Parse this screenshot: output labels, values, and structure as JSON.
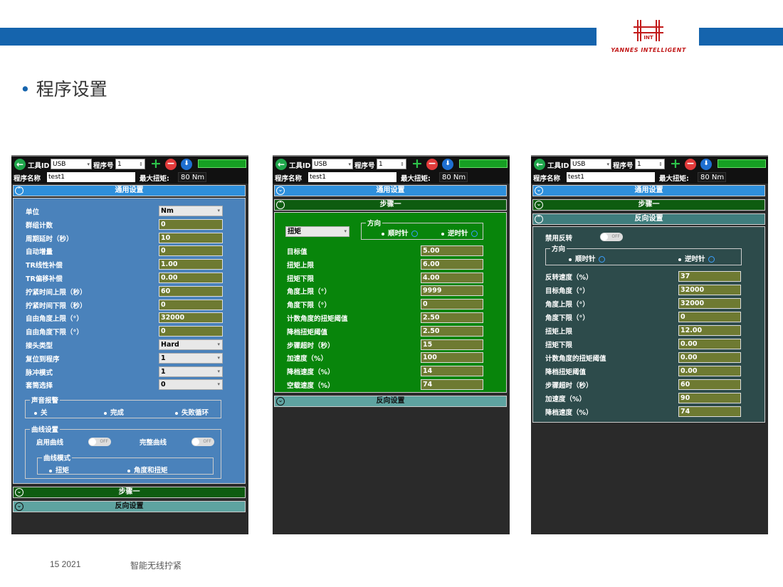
{
  "slide": {
    "title": "程序设置",
    "footer_number": "15  2021",
    "footer_text": "智能无线拧紧",
    "logo_text": "YANNES INTELLIGENT",
    "logo_mark": "INT",
    "brand_color": "#1564ad"
  },
  "toolbar": {
    "tool_id_label": "工具ID",
    "tool_id_value": "USB",
    "program_no_label": "程序号",
    "program_no_value": "1",
    "program_name_label": "程序名称",
    "program_name_value": "test1",
    "max_torque_label": "最大扭矩:",
    "max_torque_value": "80 Nm"
  },
  "sections": {
    "general": "通用设置",
    "step1": "步骤一",
    "reverse": "反向设置"
  },
  "general_settings": {
    "fields": [
      {
        "label": "单位",
        "value": "Nm",
        "kind": "select"
      },
      {
        "label": "群组计数",
        "value": "0",
        "kind": "input"
      },
      {
        "label": "周期延时（秒）",
        "value": "10",
        "kind": "input"
      },
      {
        "label": "自动增量",
        "value": "0",
        "kind": "input"
      },
      {
        "label": "TR线性补偿",
        "value": "1.00",
        "kind": "input"
      },
      {
        "label": "TR偏移补偿",
        "value": "0.00",
        "kind": "input"
      },
      {
        "label": "拧紧时间上限（秒）",
        "value": "60",
        "kind": "input"
      },
      {
        "label": "拧紧时间下限（秒）",
        "value": "0",
        "kind": "input"
      },
      {
        "label": "自由角度上限（°）",
        "value": "32000",
        "kind": "input"
      },
      {
        "label": "自由角度下限（°）",
        "value": "0",
        "kind": "input"
      },
      {
        "label": "接头类型",
        "value": "Hard",
        "kind": "select"
      },
      {
        "label": "复位到程序",
        "value": "1",
        "kind": "select"
      },
      {
        "label": "脉冲模式",
        "value": "1",
        "kind": "select"
      },
      {
        "label": "套筒选择",
        "value": "0",
        "kind": "select"
      }
    ],
    "sound_alarm": {
      "title": "声音报警",
      "options": [
        "关",
        "完成",
        "失败循环"
      ]
    },
    "curve": {
      "title": "曲线设置",
      "enable_label": "启用曲线",
      "complete_label": "完整曲线",
      "toggle_off": "OFF",
      "mode_title": "曲线模式",
      "mode_options": [
        "扭矩",
        "角度和扭矩"
      ]
    }
  },
  "step1": {
    "mode_value": "扭矩",
    "direction_title": "方向",
    "direction_options": [
      "顺时针",
      "逆时针"
    ],
    "fields": [
      {
        "label": "目标值",
        "value": "5.00"
      },
      {
        "label": "扭矩上限",
        "value": "6.00"
      },
      {
        "label": "扭矩下限",
        "value": "4.00"
      },
      {
        "label": "角度上限（°）",
        "value": "9999"
      },
      {
        "label": "角度下限（°）",
        "value": "0"
      },
      {
        "label": "计数角度的扭矩阈值",
        "value": "2.50"
      },
      {
        "label": "降档扭矩阈值",
        "value": "2.50"
      },
      {
        "label": "步骤超时（秒）",
        "value": "15"
      },
      {
        "label": "加速度（%）",
        "value": "100"
      },
      {
        "label": "降档速度（%）",
        "value": "14"
      },
      {
        "label": "空载速度（%）",
        "value": "74"
      }
    ]
  },
  "reverse": {
    "disable_label": "禁用反转",
    "toggle_off": "OFF",
    "direction_title": "方向",
    "direction_options": [
      "顺时针",
      "逆时针"
    ],
    "fields": [
      {
        "label": "反转速度（%）",
        "value": "37"
      },
      {
        "label": "目标角度（°）",
        "value": "32000"
      },
      {
        "label": "角度上限（°）",
        "value": "32000"
      },
      {
        "label": "角度下限（°）",
        "value": "0"
      },
      {
        "label": "扭矩上限",
        "value": "12.00"
      },
      {
        "label": "扭矩下限",
        "value": "0.00"
      },
      {
        "label": "计数角度的扭矩阈值",
        "value": "0.00"
      },
      {
        "label": "降档扭矩阈值",
        "value": "0.00"
      },
      {
        "label": "步骤超时（秒）",
        "value": "60"
      },
      {
        "label": "加速度（%）",
        "value": "90"
      },
      {
        "label": "降档速度（%）",
        "value": "74"
      }
    ]
  }
}
